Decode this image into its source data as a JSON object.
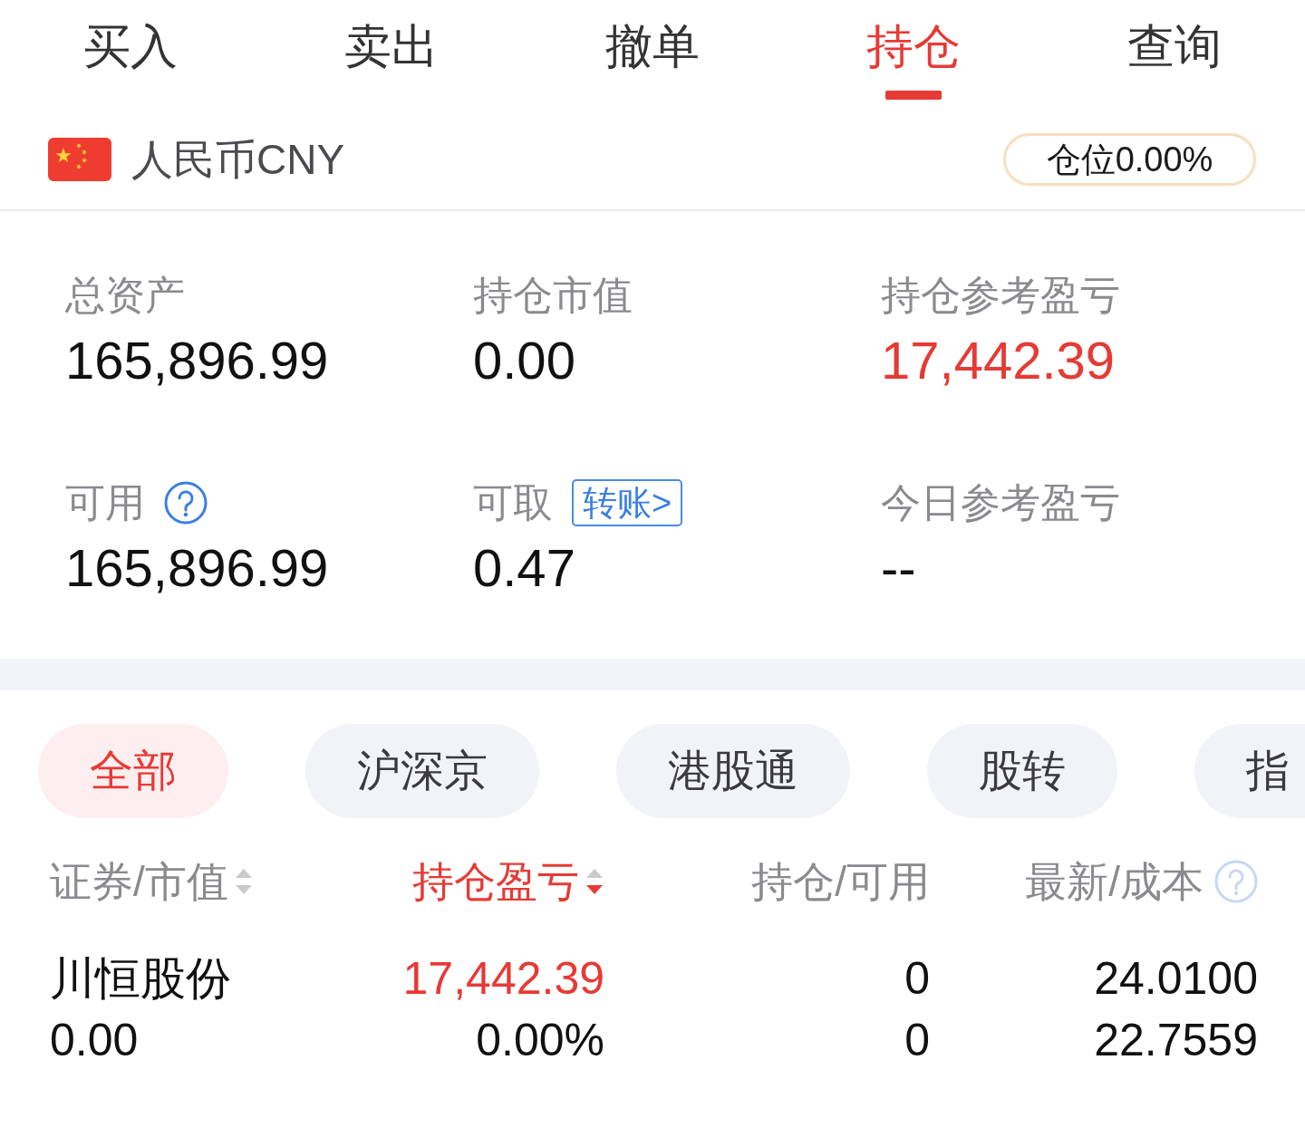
{
  "tabs": [
    {
      "label": "买入",
      "selected": false
    },
    {
      "label": "卖出",
      "selected": false
    },
    {
      "label": "撤单",
      "selected": false
    },
    {
      "label": "持仓",
      "selected": true
    },
    {
      "label": "查询",
      "selected": false
    }
  ],
  "account": {
    "currency": "人民币CNY",
    "position": "仓位0.00%"
  },
  "summary": [
    {
      "label": "总资产",
      "value": "165,896.99",
      "gain": false,
      "help": false
    },
    {
      "label": "持仓市值",
      "value": "0.00",
      "gain": false,
      "help": false
    },
    {
      "label": "持仓参考盈亏",
      "value": "17,442.39",
      "gain": true,
      "help": false
    },
    {
      "label": "可用",
      "value": "165,896.99",
      "gain": false,
      "help": true
    },
    {
      "label": "可取",
      "value": "0.47",
      "gain": false,
      "help": false,
      "action": "转账>"
    },
    {
      "label": "今日参考盈亏",
      "value": "--",
      "gain": false,
      "help": false
    }
  ],
  "filters": [
    {
      "label": "全部",
      "selected": true
    },
    {
      "label": "沪深京",
      "selected": false
    },
    {
      "label": "港股通",
      "selected": false
    },
    {
      "label": "股转",
      "selected": false
    },
    {
      "label": "指",
      "selected": false
    }
  ],
  "table": {
    "columns": [
      {
        "label": "证券/市值",
        "sortable": true,
        "sorted": false,
        "help": false
      },
      {
        "label": "持仓盈亏",
        "sortable": true,
        "sorted": true,
        "help": false
      },
      {
        "label": "持仓/可用",
        "sortable": false,
        "sorted": false,
        "help": false
      },
      {
        "label": "最新/成本",
        "sortable": false,
        "sorted": false,
        "help": true
      }
    ],
    "rows": [
      {
        "name": "川恒股份",
        "market_value": "0.00",
        "pnl": "17,442.39",
        "pnl_gain": true,
        "pnl_ratio": "0.00%",
        "holding": "0",
        "available": "0",
        "latest": "24.0100",
        "cost": "22.7559"
      }
    ]
  }
}
